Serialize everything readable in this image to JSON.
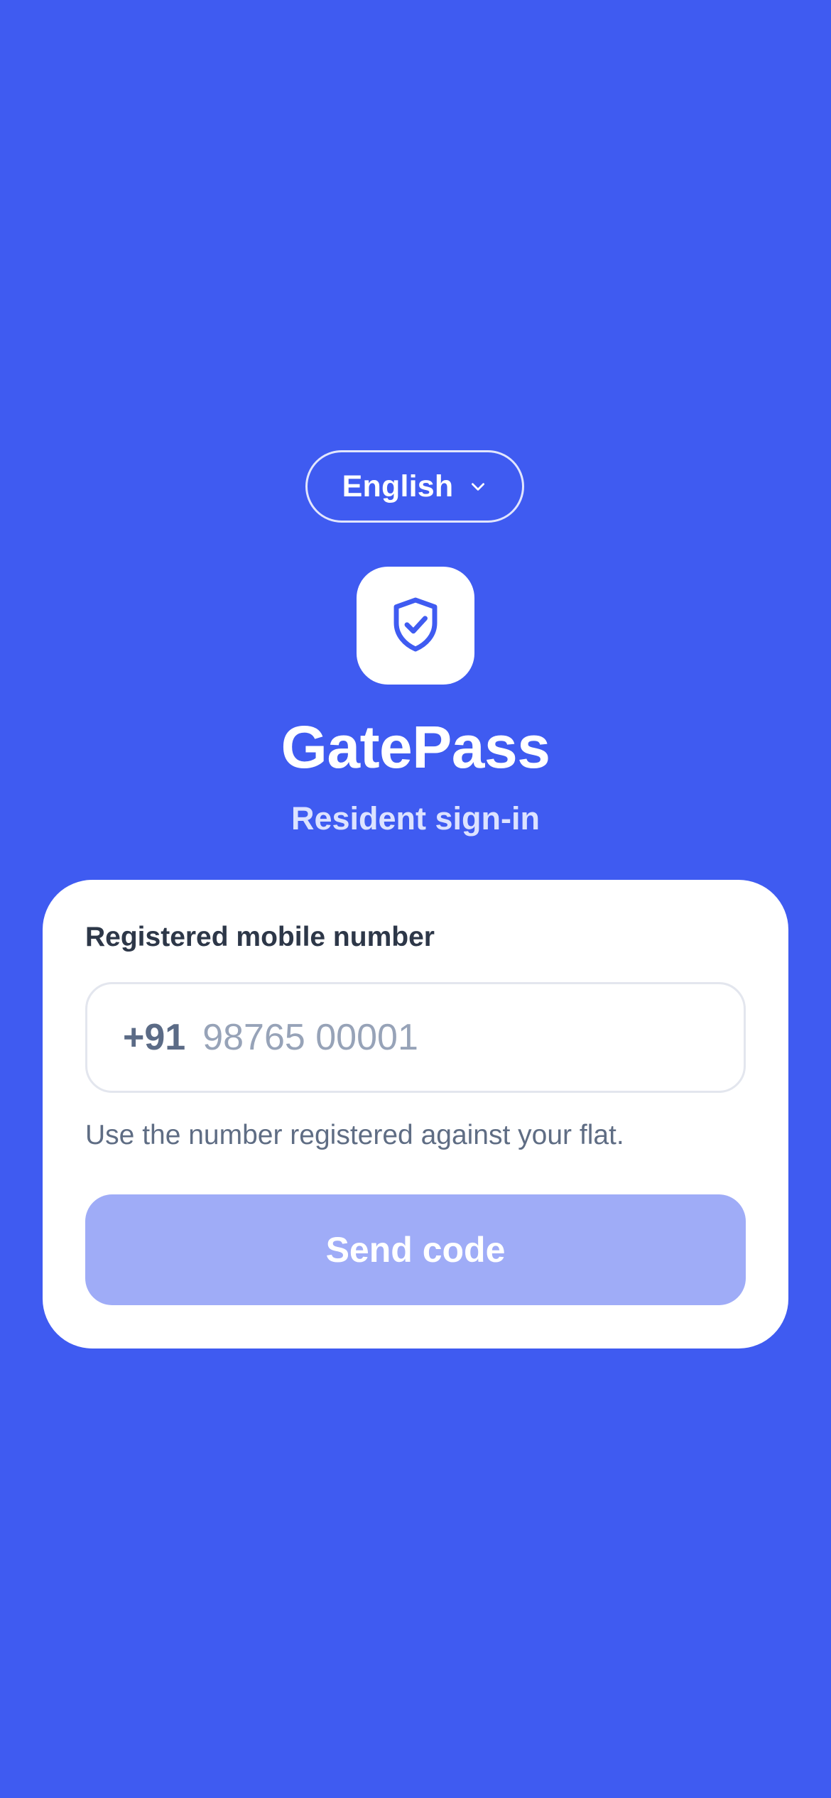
{
  "colors": {
    "background": "#3F5BF1",
    "card": "#FFFFFF",
    "button_disabled": "#9FACF7",
    "icon_accent": "#3F5BF1"
  },
  "language": {
    "selected": "English",
    "icon": "chevron-down-icon"
  },
  "app": {
    "icon": "shield-check-icon",
    "title": "GatePass",
    "subtitle": "Resident sign-in"
  },
  "form": {
    "label": "Registered mobile number",
    "country_code": "+91",
    "phone_value": "",
    "phone_placeholder": "98765 00001",
    "helper": "Use the number registered against your flat.",
    "submit_label": "Send code",
    "submit_disabled": true
  }
}
